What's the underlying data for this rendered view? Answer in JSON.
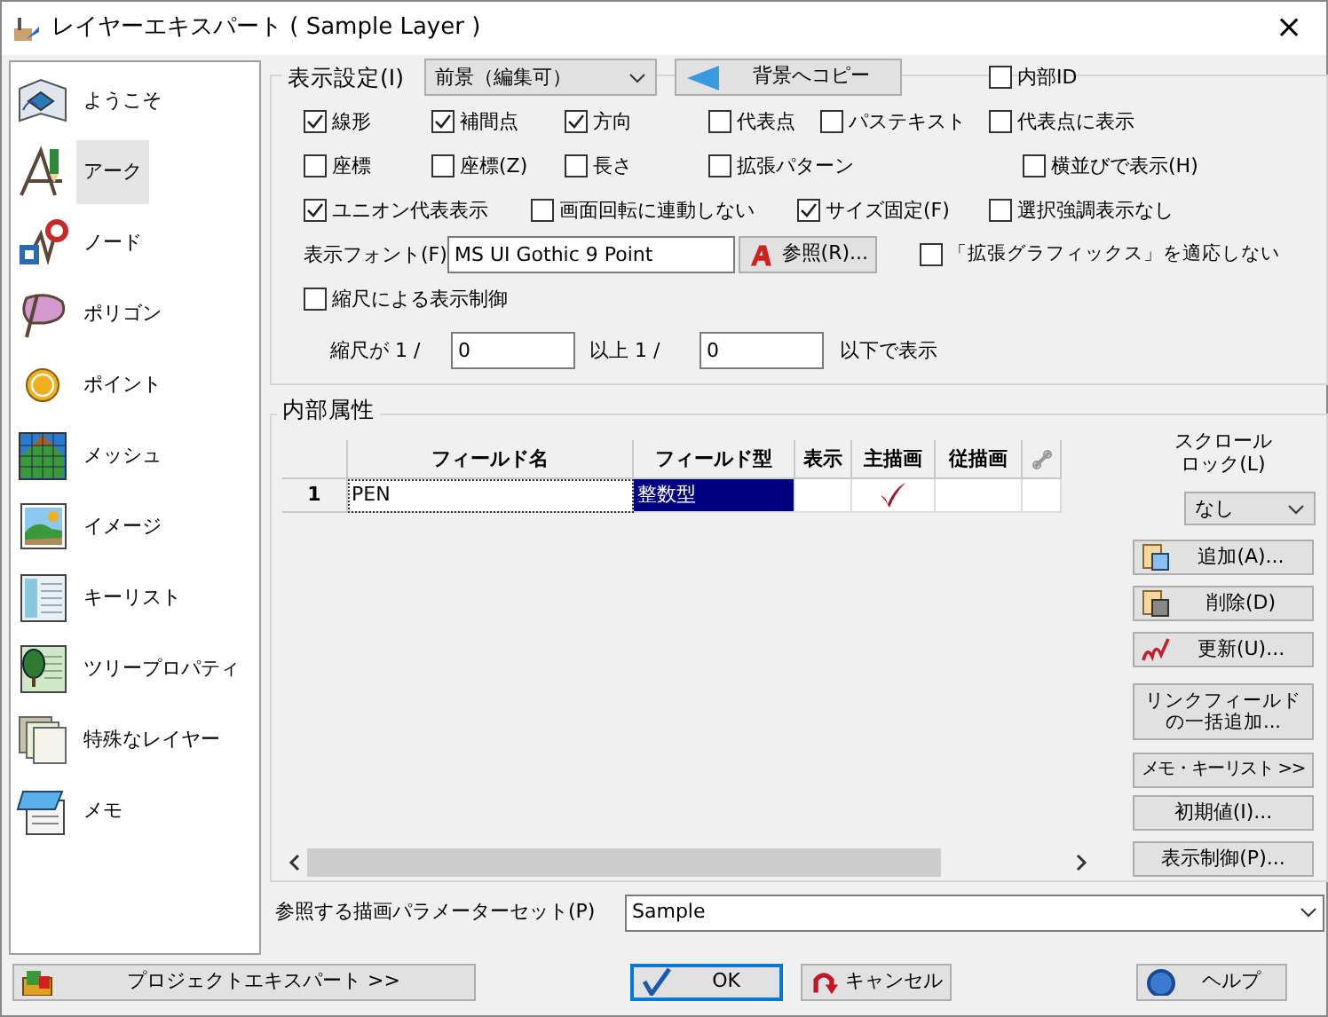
{
  "window": {
    "title": "レイヤーエキスパート ( Sample Layer )",
    "close": "×"
  },
  "sidebar": {
    "items": [
      {
        "label": "ようこそ",
        "selected": false
      },
      {
        "label": "アーク",
        "selected": true
      },
      {
        "label": "ノード",
        "selected": false
      },
      {
        "label": "ポリゴン",
        "selected": false
      },
      {
        "label": "ポイント",
        "selected": false
      },
      {
        "label": "メッシュ",
        "selected": false
      },
      {
        "label": "イメージ",
        "selected": false
      },
      {
        "label": "キーリスト",
        "selected": false
      },
      {
        "label": "ツリープロパティ",
        "selected": false
      },
      {
        "label": "特殊なレイヤー",
        "selected": false
      },
      {
        "label": "メモ",
        "selected": false
      }
    ]
  },
  "display_settings": {
    "rows": [
      [
        {
          "kind": "legend",
          "text": "表示設定(I)"
        },
        {
          "kind": "select",
          "text": "前景（編集可）"
        },
        {
          "kind": "button",
          "text": "背景へコピー"
        },
        {
          "kind": "checkbox",
          "text": "内部ID",
          "checked": false
        }
      ],
      [
        {
          "kind": "checkbox",
          "text": "線形",
          "checked": true
        },
        {
          "kind": "checkbox",
          "text": "補間点",
          "checked": true
        },
        {
          "kind": "checkbox",
          "text": "方向",
          "checked": true
        },
        {
          "kind": "checkbox",
          "text": "代表点",
          "checked": false
        },
        {
          "kind": "checkbox",
          "text": "パステキスト",
          "checked": false
        },
        {
          "kind": "checkbox",
          "text": "代表点に表示",
          "checked": false
        }
      ],
      [
        {
          "kind": "checkbox",
          "text": "座標",
          "checked": false
        },
        {
          "kind": "checkbox",
          "text": "座標(Z)",
          "checked": false
        },
        {
          "kind": "checkbox",
          "text": "長さ",
          "checked": false
        },
        {
          "kind": "checkbox",
          "text": "拡張パターン",
          "checked": false
        },
        "",
        {
          "kind": "checkbox",
          "text": "横並びで表示(H)",
          "checked": false
        }
      ],
      [
        {
          "kind": "checkbox",
          "text": "ユニオン代表表示",
          "checked": true
        },
        {
          "kind": "checkbox",
          "text": "画面回転に連動しない",
          "checked": false
        },
        {
          "kind": "checkbox",
          "text": "サイズ固定(F)",
          "checked": true
        },
        {
          "kind": "checkbox",
          "text": "選択強調表示なし",
          "checked": false
        }
      ],
      [
        {
          "kind": "label",
          "text": "表示フォント(F)"
        },
        {
          "kind": "field",
          "text": "MS UI Gothic 9 Point"
        },
        {
          "kind": "button",
          "text": "参照(R)..."
        },
        {
          "kind": "checkbox",
          "text": "「拡張グラフィックス」を適応しない",
          "checked": false
        }
      ],
      [
        {
          "kind": "checkbox",
          "text": "縮尺による表示制御",
          "checked": false
        }
      ],
      [
        {
          "kind": "label",
          "text": "縮尺が  1 /"
        },
        {
          "kind": "field",
          "text": "0"
        },
        {
          "kind": "label",
          "text": "以上   1 /"
        },
        {
          "kind": "field",
          "text": "0"
        },
        {
          "kind": "label",
          "text": "以下で表示"
        }
      ]
    ]
  },
  "attributes": {
    "legend": "内部属性",
    "table": {
      "columns": [
        "フィールド名",
        "フィールド型",
        "表示",
        "主描画",
        "従描画"
      ],
      "rows": [
        {
          "number": "1",
          "name": "PEN",
          "type": "整数型",
          "type_selected": true,
          "display": false,
          "main_draw": true,
          "sub_draw": false
        }
      ]
    },
    "scroll_lock": {
      "label": [
        "スクロール",
        "ロック(L)"
      ],
      "value": "なし"
    },
    "buttons": [
      "追加(A)...",
      "削除(D)",
      "更新(U)...",
      "リンクフィールドの一括追加...",
      "メモ・キーリスト >>",
      "初期値(I)...",
      "表示制御(P)..."
    ]
  },
  "param_set": {
    "label": "参照する描画パラメーターセット(P)",
    "value": "Sample"
  },
  "footer": {
    "buttons": [
      {
        "text": "プロジェクトエキスパート >>",
        "default": false
      },
      {
        "text": "OK",
        "default": true
      },
      {
        "text": "キャンセル",
        "default": false
      },
      {
        "text": "ヘルプ",
        "default": false
      }
    ]
  }
}
